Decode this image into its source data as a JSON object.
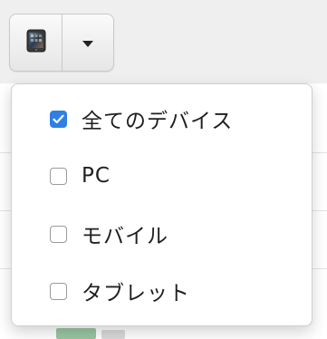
{
  "toolbar": {
    "device_button_icon": "tablet-icon",
    "caret_icon": "caret-down-icon"
  },
  "device_filter_menu": {
    "items": [
      {
        "label": "全てのデバイス",
        "checked": true
      },
      {
        "label": "PC",
        "checked": false
      },
      {
        "label": "モバイル",
        "checked": false
      },
      {
        "label": "タブレット",
        "checked": false
      }
    ]
  },
  "colors": {
    "checkbox_checked": "#2f7fe6",
    "text": "#1f1f1f",
    "border": "#cfcfcf"
  }
}
